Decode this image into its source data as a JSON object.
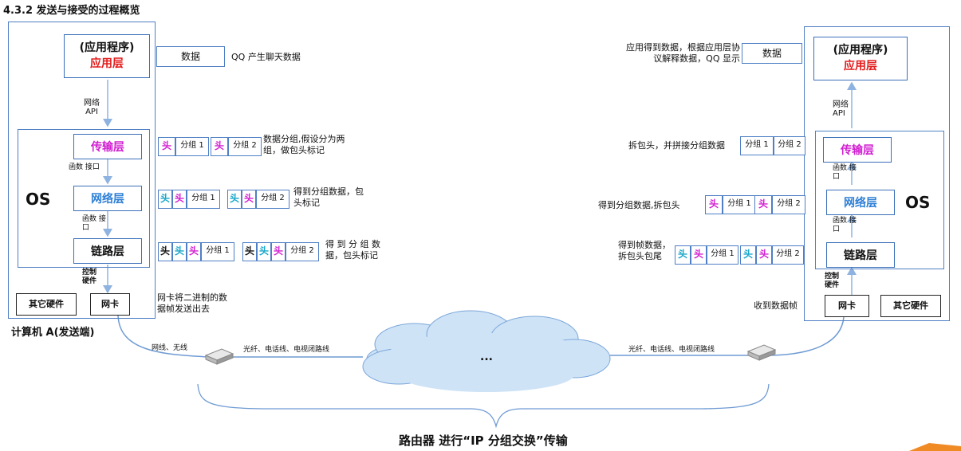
{
  "title": "4.3.2 发送与接受的过程概览",
  "sender": {
    "app_line1": "(应用程序)",
    "app_line2": "应用层",
    "api_label": "网络 API",
    "transport": "传输层",
    "network": "网络层",
    "link": "链路层",
    "func1": "函数 接口",
    "func2": "函数 接口",
    "os": "OS",
    "ctrl_hw": "控制 硬件",
    "other_hw": "其它硬件",
    "nic": "网卡",
    "computer": "计算机 A(发送端)",
    "data_box": "数据",
    "data_note": "QQ 产生聊天数据",
    "seg_note": "数据分组,假设分为两组，做包头标记",
    "net_note": "得到分组数据，包头标记",
    "link_note": "得 到 分 组 数 据，包头标记",
    "nic_note": "网卡将二进制的数据帧发送出去",
    "cable": "网线、无线"
  },
  "receiver": {
    "app_line1": "(应用程序)",
    "app_line2": "应用层",
    "api_label": "网络 API",
    "transport": "传输层",
    "network": "网络层",
    "link": "链路层",
    "func1": "函数 接口",
    "func2": "函数 接口",
    "os": "OS",
    "ctrl_hw": "控制 硬件",
    "other_hw": "其它硬件",
    "nic": "网卡",
    "data_box": "数据",
    "app_note": "应用得到数据，根据应用层协议解释数据，QQ 显示",
    "trans_note": "拆包头，并拼接分组数据",
    "net_note": "得到分组数据,拆包头",
    "link_note": "得到帧数据，拆包头包尾",
    "nic_note": "收到数据帧"
  },
  "packets": {
    "head": "头",
    "seg1": "分组 1",
    "seg2": "分组 2"
  },
  "network": {
    "fiber_left": "光纤、电话线、电视闭路线",
    "fiber_right": "光纤、电话线、电视闭路线",
    "cloud": "...",
    "caption": "路由器 进行“IP 分组交换”传输"
  },
  "colors": {
    "frame": "#4f7fc4",
    "arrow": "#8fb3e0",
    "red": "#e31b1b",
    "magenta": "#d11ed1",
    "blue": "#2e7fd6",
    "cyan": "#16a6c9",
    "cloud": "#cfe3f7"
  }
}
